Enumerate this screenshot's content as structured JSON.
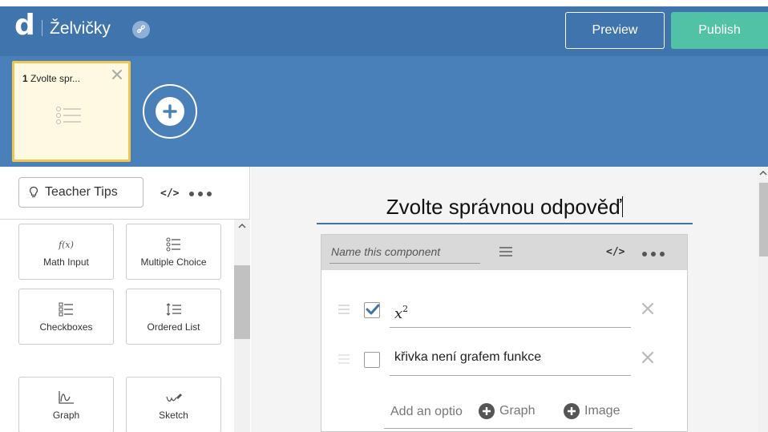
{
  "header": {
    "logo_char": "d",
    "title": "Želvičky",
    "preview_label": "Preview",
    "publish_label": "Publish"
  },
  "screens": [
    {
      "number": "1",
      "title": "Zvolte spr..."
    }
  ],
  "sidebar": {
    "teacher_tips_label": "Teacher Tips",
    "code_label": "</>",
    "components": [
      {
        "label": "Math Input",
        "icon": "fx-icon",
        "glyph": "f(x)"
      },
      {
        "label": "Multiple Choice",
        "icon": "multiple-choice-icon"
      },
      {
        "label": "Checkboxes",
        "icon": "checkboxes-icon"
      },
      {
        "label": "Ordered List",
        "icon": "ordered-list-icon"
      },
      {
        "label": "Graph",
        "icon": "graph-icon"
      },
      {
        "label": "Sketch",
        "icon": "sketch-icon"
      }
    ]
  },
  "editor": {
    "question_title": "Zvolte správnou odpověď",
    "component_name_placeholder": "Name this component",
    "code_label": "</>",
    "options": [
      {
        "text": "x",
        "superscript": "2",
        "checked": true
      },
      {
        "text": "křivka není grafem funkce",
        "checked": false
      }
    ],
    "add_option_label": "Add an optio",
    "add_graph_label": "Graph",
    "add_image_label": "Image"
  },
  "colors": {
    "header_blue": "#3f74ad",
    "screens_blue": "#4a80b9",
    "publish_green": "#52c2a6",
    "active_screen_border": "#f2c64e",
    "checkbox_blue": "#3f74ad"
  }
}
